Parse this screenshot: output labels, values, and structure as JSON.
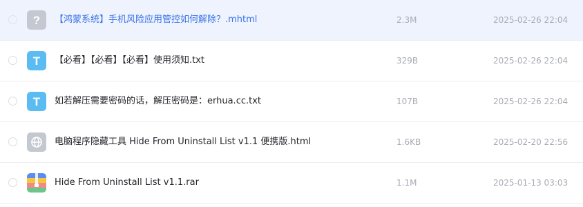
{
  "files": [
    {
      "name": "【鸿蒙系统】手机风险应用管控如何解除？.mhtml",
      "size": "2.3M",
      "date": "2025-02-26 22:04",
      "icon": "unknown-file-icon",
      "icon_glyph": "?",
      "icon_color": "#c4c8d0"
    },
    {
      "name": "【必看】【必看】【必看】使用须知.txt",
      "size": "329B",
      "date": "2025-02-26 22:04",
      "icon": "text-file-icon",
      "icon_glyph": "T",
      "icon_color": "#5bbcf2"
    },
    {
      "name": "如若解压需要密码的话，解压密码是：erhua.cc.txt",
      "size": "107B",
      "date": "2025-02-26 22:04",
      "icon": "text-file-icon",
      "icon_glyph": "T",
      "icon_color": "#5bbcf2"
    },
    {
      "name": "电脑程序隐藏工具 Hide From Uninstall List v1.1 便携版.html",
      "size": "1.6KB",
      "date": "2025-02-20 22:56",
      "icon": "web-file-icon",
      "icon_color": "#c4c8d0"
    },
    {
      "name": "Hide From Uninstall List v1.1.rar",
      "size": "1.1M",
      "date": "2025-01-13 03:03",
      "icon": "archive-file-icon",
      "icon_color": "#5b8cf0"
    }
  ],
  "colors": {
    "hover_row": "#eef3fe",
    "hover_link": "#3a73e6",
    "meta_text": "#a7abb3"
  }
}
